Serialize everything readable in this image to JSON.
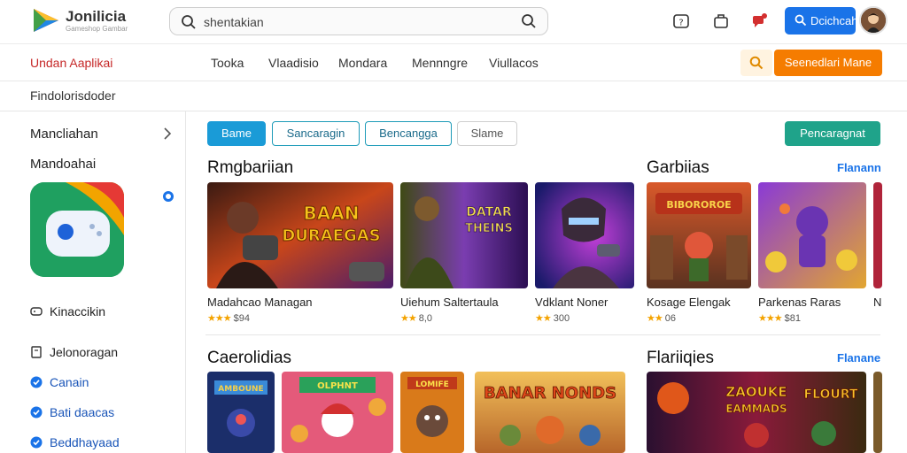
{
  "header": {
    "brand": "Jonilicia",
    "brand_sub": "Gameshop Gambar",
    "search_value": "shentakian",
    "login_label": "Dcichcah"
  },
  "navbar": {
    "title": "Undan Aaplikai",
    "items": [
      "Tooka",
      "Vlaadisio",
      "Mondara",
      "Mennngre",
      "Viullacos"
    ],
    "cta": "Seenedlari Mane"
  },
  "breadcrumb": "Findolorisdoder",
  "sidebar": {
    "heading": "Mancliahan",
    "subheading": "Mandoahai",
    "rows": [
      {
        "label": "Kinaccikin",
        "icon": "gamepad-icon",
        "style": "plain"
      },
      {
        "label": "Jelonoragan",
        "icon": "bookmark-icon",
        "style": "plain"
      },
      {
        "label": "Canain",
        "icon": "check-badge-icon",
        "style": "blue"
      },
      {
        "label": "Bati daacas",
        "icon": "check-badge-icon",
        "style": "blue"
      },
      {
        "label": "Beddhayaad",
        "icon": "check-badge-icon",
        "style": "blue"
      }
    ]
  },
  "filters": {
    "chips": [
      "Bame",
      "Sancaragin",
      "Bencangga",
      "Slame"
    ],
    "action": "Pencaragnat"
  },
  "sections": {
    "top_left_title": "Rmgbariian",
    "top_right_title": "Garbiias",
    "top_right_link": "Flanann",
    "bottom_left_title": "Caerolidias",
    "bottom_right_title": "Flariiqies",
    "bottom_right_link": "Flanane"
  },
  "top_cards": [
    {
      "name": "Madahcao Managan",
      "meta": "$94",
      "stars": "★★★",
      "art": "BAAN DURAEGAS"
    },
    {
      "name": "Uiehum Saltertaula",
      "meta": "8,0",
      "stars": "★★",
      "art": "DATAR THEINS"
    },
    {
      "name": "Vdklant Noner",
      "meta": "300",
      "stars": "★★",
      "art": ""
    },
    {
      "name": "Kosage Elengak",
      "meta": "06",
      "stars": "★★",
      "art": "BIBOROROE"
    },
    {
      "name": "Parkenas Raras",
      "meta": "$81",
      "stars": "★★★",
      "art": ""
    },
    {
      "name": "N",
      "meta": "",
      "stars": "",
      "art": ""
    }
  ],
  "bottom_cards": [
    {
      "art": "AMBOUNE"
    },
    {
      "art": "OLPHNT"
    },
    {
      "art": "LOMIFE"
    },
    {
      "art": "BANAR NONDS"
    },
    {
      "art": "ZAOUKE EAMMADS FLOURT"
    }
  ],
  "colors": {
    "primary": "#1a73e8",
    "accent_orange": "#f57c00",
    "teal": "#1fa38a",
    "nav_title_red": "#c62828"
  }
}
